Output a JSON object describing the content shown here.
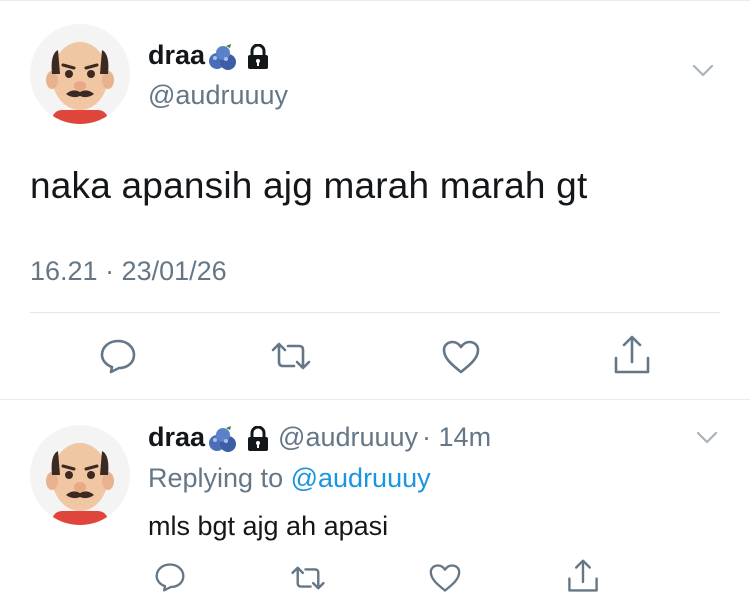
{
  "main_tweet": {
    "display_name": "draa",
    "handle": "@audruuuy",
    "text": "naka apansih ajg marah marah gt",
    "timestamp": "16.21 · 23/01/26"
  },
  "reply_tweet": {
    "display_name": "draa",
    "handle": "@audruuuy",
    "time": "· 14m",
    "replying_prefix": "Replying to",
    "replying_handle": "@audruuuy",
    "text": "mls bgt ajg ah apasi"
  },
  "icons": {
    "emoji_badge": "blueberries-emoji-icon",
    "lock": "lock-icon",
    "menu": "chevron-down-icon",
    "reply": "reply-icon",
    "retweet": "retweet-icon",
    "like": "heart-icon",
    "share": "share-icon"
  },
  "colors": {
    "text": "#14171a",
    "secondary": "#657786",
    "link": "#1b95e0",
    "divider": "#e1e8ed"
  }
}
